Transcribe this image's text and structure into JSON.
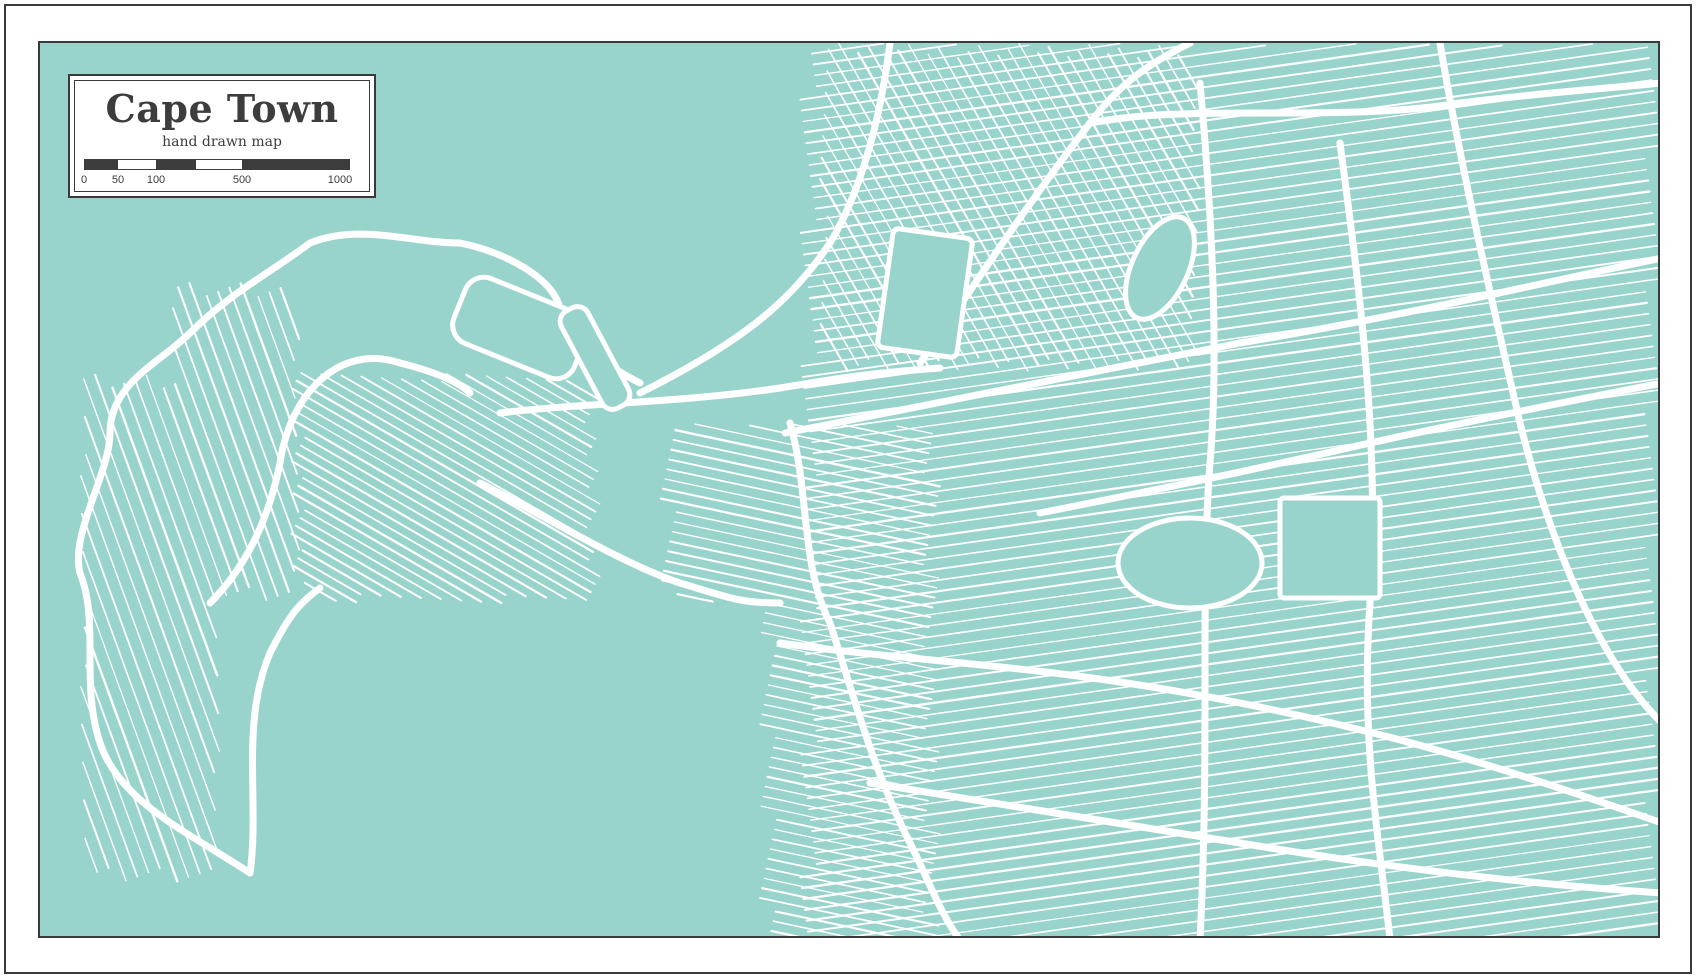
{
  "map": {
    "title": "Cape Town",
    "subtitle": "hand drawn map",
    "scale_labels": [
      "0",
      "50",
      "100",
      "500",
      "1000"
    ],
    "colors": {
      "land": "#98d4cb",
      "water": "#98d4cb",
      "roads": "#ffffff",
      "frame": "#3a3a3a",
      "text": "#3d3d3d"
    }
  }
}
